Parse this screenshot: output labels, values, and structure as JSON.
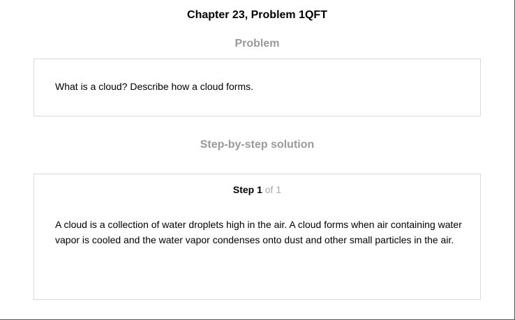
{
  "header": {
    "chapter_title": "Chapter 23, Problem 1QFT"
  },
  "problem": {
    "heading": "Problem",
    "text": "What is a cloud? Describe how a cloud forms."
  },
  "solution": {
    "heading": "Step-by-step solution",
    "step_label": "Step 1",
    "step_of": "of 1",
    "text": "A cloud is a collection of water droplets high in the air. A cloud forms when air containing water vapor is cooled and the water vapor condenses onto dust and other small particles in the air."
  },
  "colors": {
    "heading_gray": "#9a9a9a",
    "card_border": "#d9d9d9",
    "step_of_gray": "#aaaaaa"
  }
}
